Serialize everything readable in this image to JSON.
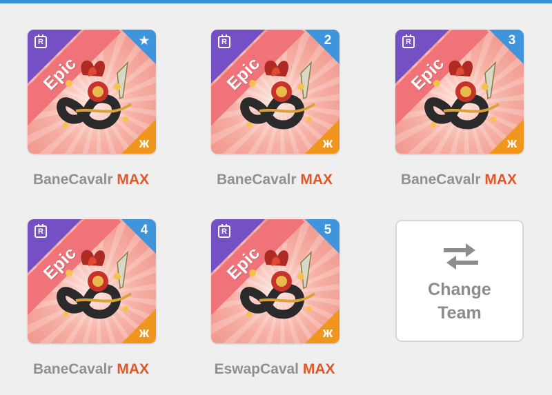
{
  "team": {
    "slots": [
      {
        "rarity": "Epic",
        "slot_label": "★",
        "element_icon": "ж",
        "creature_name": "BaneCavalr",
        "level_badge": "MAX"
      },
      {
        "rarity": "Epic",
        "slot_label": "2",
        "element_icon": "ж",
        "creature_name": "BaneCavalr",
        "level_badge": "MAX"
      },
      {
        "rarity": "Epic",
        "slot_label": "3",
        "element_icon": "ж",
        "creature_name": "BaneCavalr",
        "level_badge": "MAX"
      },
      {
        "rarity": "Epic",
        "slot_label": "4",
        "element_icon": "ж",
        "creature_name": "BaneCavalr",
        "level_badge": "MAX"
      },
      {
        "rarity": "Epic",
        "slot_label": "5",
        "element_icon": "ж",
        "creature_name": "EswapCaval",
        "level_badge": "MAX"
      }
    ],
    "change_team": {
      "line1": "Change",
      "line2": "Team",
      "icon": "swap-arrows-icon"
    }
  },
  "colors": {
    "top_bar": "#3a8fd6",
    "rarity_epic": "#f0737a",
    "top_left_corner": "#7550c4",
    "slot_badge": "#3f95db",
    "element_badge": "#f0961e",
    "max_label": "#e1572a",
    "name_text": "#909090"
  }
}
